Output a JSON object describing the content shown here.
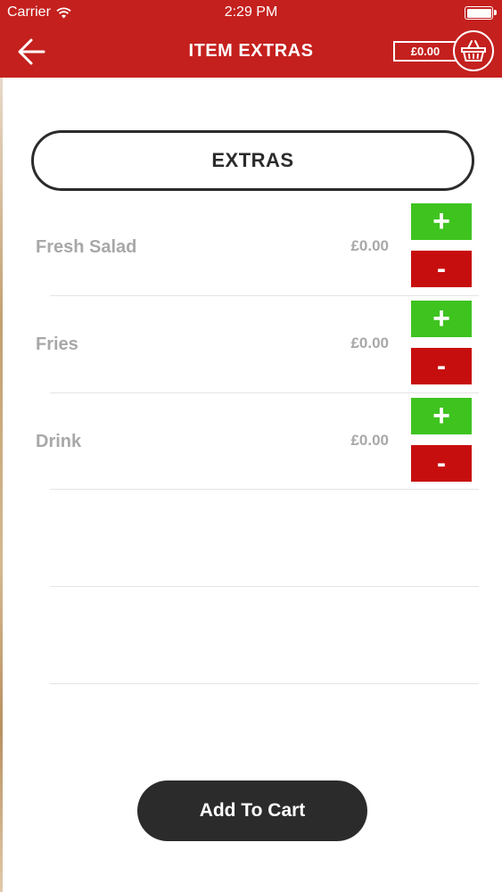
{
  "status_bar": {
    "carrier": "Carrier",
    "time": "2:29 PM",
    "icons": [
      "wifi-icon",
      "battery-icon"
    ]
  },
  "nav": {
    "back_icon": "back-arrow-icon",
    "title": "ITEM EXTRAS",
    "cart_total": "£0.00",
    "basket_icon": "basket-icon"
  },
  "extras_header": "EXTRAS",
  "extras": [
    {
      "name": "Fresh Salad",
      "price": "£0.00",
      "add_label": "+",
      "remove_label": "-"
    },
    {
      "name": "Fries",
      "price": "£0.00",
      "add_label": "+",
      "remove_label": "-"
    },
    {
      "name": "Drink",
      "price": "£0.00",
      "add_label": "+",
      "remove_label": "-"
    }
  ],
  "add_to_cart_label": "Add To Cart",
  "colors": {
    "brand_red": "#c4201e",
    "plus_green": "#3ec31f",
    "minus_red": "#c70e0e",
    "dark": "#2b2b2b",
    "muted_text": "#a8a8a8"
  }
}
